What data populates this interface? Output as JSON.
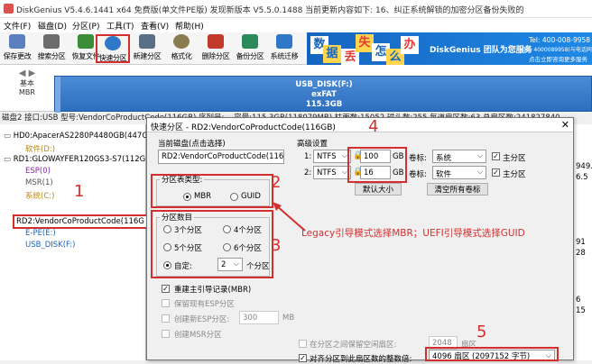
{
  "window": {
    "title": "DiskGenius V5.4.6.1441 x64 免费版(单文件PE版)   发现新版本 V5.5.0.1488  当前更新内容如下: 16、纠正系统解锁的加密分区备份失败的"
  },
  "menu": [
    "文件(F)",
    "磁盘(D)",
    "分区(P)",
    "工具(T)",
    "查看(V)",
    "帮助(H)"
  ],
  "toolbar": [
    {
      "label": "保存更改",
      "color": "#5b7fbf"
    },
    {
      "label": "搜索分区",
      "color": "#6c6c6c"
    },
    {
      "label": "恢复文件",
      "color": "#3a8e3a"
    },
    {
      "label": "快速分区",
      "color": "#2e78c7"
    },
    {
      "label": "新建分区",
      "color": "#5a6f86"
    },
    {
      "label": "格式化",
      "color": "#8a7c4e"
    },
    {
      "label": "删除分区",
      "color": "#c0392b"
    },
    {
      "label": "备份分区",
      "color": "#2a8a5a"
    },
    {
      "label": "系统迁移",
      "color": "#2e78c7"
    }
  ],
  "ad": {
    "chars": [
      "数",
      "据",
      "丢",
      "失",
      "怎",
      "么",
      "办"
    ],
    "brand": "DiskGenius 团队为您服务",
    "phone": "Tel: 400-008-9958",
    "qq": "QQ: 4000089958(与电话同号)",
    "note": "点击立即咨询更多服务"
  },
  "disk_strip": {
    "label1": "基本",
    "label2": "MBR",
    "partition_name": "USB_DISK(F:)",
    "fs": "exFAT",
    "size": "115.3GB"
  },
  "info_line": "磁盘2 接口:USB  型号:VendorCoProductCode(116GB)  序列号:...  容量:115.3GB(118079MB)  柱面数:15052  磁头数:255  每道扇区数:63  总扇区数:241827840",
  "tree": [
    {
      "label": "HD0:ApacerAS2280P4480GB(447G",
      "indent": 0,
      "color": "#000"
    },
    {
      "label": "软件(D:)",
      "indent": 1,
      "color": "#b8860b"
    },
    {
      "label": "RD1:GLOWAYFER120GS3-S7(112G",
      "indent": 0,
      "color": "#000"
    },
    {
      "label": "ESP(0)",
      "indent": 1,
      "color": "#8e24aa"
    },
    {
      "label": "MSR(1)",
      "indent": 1,
      "color": "#555"
    },
    {
      "label": "系统(C:)",
      "indent": 1,
      "color": "#b8860b"
    },
    {
      "label": "RD2:VendorCoProductCode(116G",
      "indent": 0,
      "color": "#000"
    },
    {
      "label": "E-PE(E:)",
      "indent": 1,
      "color": "#1565c0"
    },
    {
      "label": "USB_DISK(F:)",
      "indent": 1,
      "color": "#1565c0"
    }
  ],
  "dialog": {
    "title": "快速分区 - RD2:VendorCoProductCode(116GB)",
    "current_disk_label": "当前磁盘(点击选择)",
    "current_disk_value": "RD2:VendorCoProductCode(116G",
    "table_type_label": "分区表类型:",
    "mbr": "MBR",
    "guid": "GUID",
    "count_label": "分区数目",
    "opt3": "3个分区",
    "opt4": "4个分区",
    "opt5": "5个分区",
    "opt6": "6个分区",
    "custom": "自定:",
    "custom_value": "2",
    "custom_unit": "个分区",
    "rebuild_mbr": "重建主引导记录(MBR)",
    "keep_esp": "保留现有ESP分区",
    "create_esp": "创建新ESP分区:",
    "esp_size": "300",
    "esp_unit": "MB",
    "create_msr": "创建MSR分区",
    "adv_label": "高级设置",
    "row1": {
      "idx": "1:",
      "fs": "NTFS",
      "size": "100",
      "unit": "GB",
      "vol_label": "卷标:",
      "vol": "系统",
      "primary": "主分区"
    },
    "row2": {
      "idx": "2:",
      "fs": "NTFS",
      "size": "16",
      "unit": "GB",
      "vol_label": "卷标:",
      "vol": "软件",
      "primary": "主分区"
    },
    "default_size_btn": "默认大小",
    "clear_labels_btn": "清空所有卷标",
    "reserve_label": "在分区之间保留空闲扇区:",
    "reserve_value": "2048",
    "reserve_unit": "扇区",
    "align_label": "对齐分区到此扇区数的整数倍:",
    "align_value": "4096 扇区 (2097152 字节)"
  },
  "annotations": {
    "n1": "1",
    "n2": "2",
    "n3": "3",
    "n4": "4",
    "n5": "5",
    "note": "Legacy引导模式选择MBR；UEFI引导模式选择GUID"
  },
  "right_peek": [
    "949.",
    "6.5",
    "91",
    "28",
    "6",
    "15"
  ]
}
